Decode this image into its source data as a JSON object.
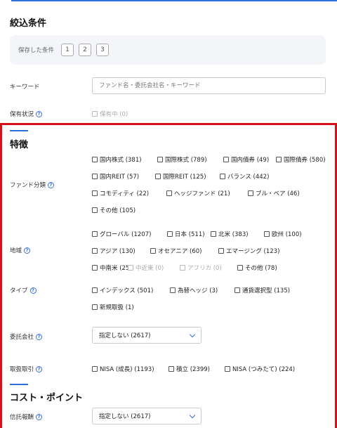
{
  "header": {
    "title": "絞込条件"
  },
  "saved": {
    "label": "保存した条件",
    "slots": [
      "1",
      "2",
      "3"
    ]
  },
  "keyword": {
    "label": "キーワード",
    "placeholder": "ファンド名・委託会社名・キーワード"
  },
  "holding": {
    "label": "保有状況",
    "option": "保有中 (0)"
  },
  "features": {
    "title": "特徴",
    "fund_category": {
      "label": "ファンド分類",
      "options": [
        "国内株式 (381)",
        "国際株式 (789)",
        "国内債券 (49)",
        "国際債券 (580)",
        "国内REIT (57)",
        "国際REIT (125)",
        "バランス (442)",
        "コモディティ (22)",
        "ヘッジファンド (21)",
        "ブル・ベア (46)",
        "その他 (105)"
      ]
    },
    "region": {
      "label": "地域",
      "options": [
        "グローバル (1207)",
        "日本 (511)",
        "北米 (383)",
        "欧州 (100)",
        "アジア (130)",
        "オセアニア (60)",
        "エマージング (123)",
        "中南米 (25)",
        "中近東 (0)",
        "アフリカ (0)",
        "その他 (78)"
      ]
    },
    "type": {
      "label": "タイプ",
      "options": [
        "インデックス (501)",
        "為替ヘッジ (3)",
        "通貨選択型 (135)",
        "新規取扱 (1)"
      ]
    },
    "company": {
      "label": "委託会社",
      "value": "指定しない (2617)"
    },
    "trading": {
      "label": "取扱取引",
      "options": [
        "NISA (成長) (1193)",
        "積立 (2399)",
        "NISA (つみたて) (224)"
      ]
    }
  },
  "cost": {
    "title": "コスト・ポイント",
    "trust_fee": {
      "label": "信託報酬",
      "value": "指定しない (2617)"
    }
  },
  "colors": {
    "accent": "#2f6fd8",
    "highlight_frame": "#d4121c"
  },
  "icons": {
    "help": "help-icon",
    "dropdown": "chevron-down-icon"
  }
}
